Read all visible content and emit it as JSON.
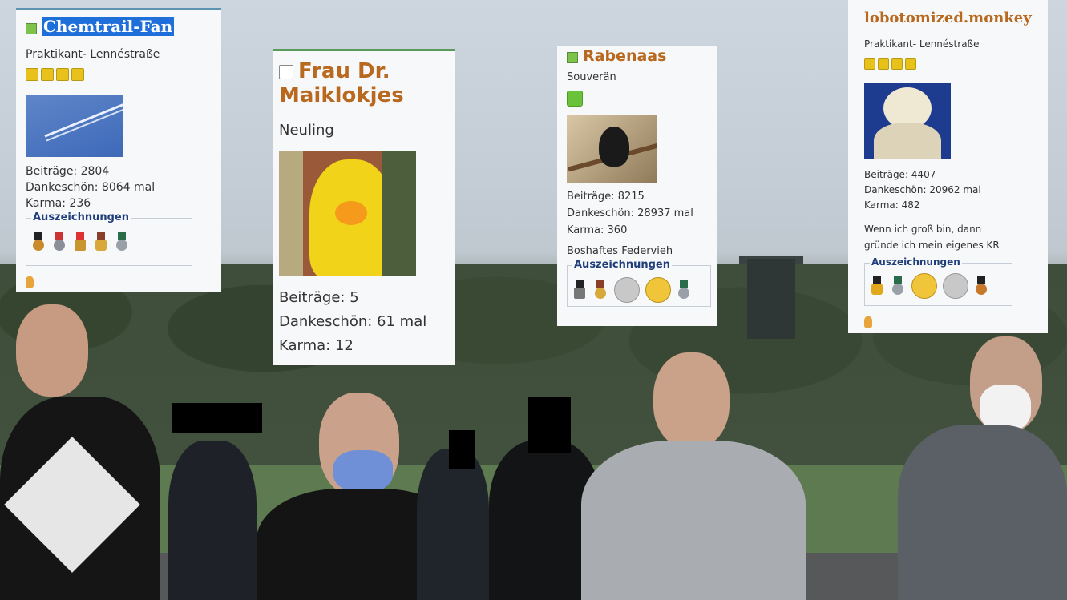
{
  "cards": [
    {
      "id": "chemtrail",
      "name": "Chemtrail-Fan",
      "rank": "Praktikant- Lennéstraße",
      "rank_pips": 4,
      "posts": "Beiträge: 2804",
      "thanks": "Dankeschön: 8064 mal",
      "karma": "Karma: 236",
      "awards_title": "Auszeichnungen",
      "avatar_icon": "airplane-contrail-avatar"
    },
    {
      "id": "maiklokjes",
      "name_line1": "Frau Dr.",
      "name_line2": "Maiklokjes",
      "rank": "Neuling",
      "posts": "Beiträge: 5",
      "thanks": "Dankeschön: 61 mal",
      "karma": "Karma: 12",
      "avatar_icon": "big-bird-avatar"
    },
    {
      "id": "rabenaas",
      "name": "Rabenaas",
      "rank": "Souverän",
      "posts": "Beiträge: 8215",
      "thanks": "Dankeschön: 28937 mal",
      "karma": "Karma: 360",
      "extra": "Boshaftes Federvieh",
      "awards_title": "Auszeichnungen",
      "avatar_icon": "raven-avatar"
    },
    {
      "id": "monkey",
      "name": "lobotomized.monkey",
      "rank": "Praktikant- Lennéstraße",
      "rank_pips": 4,
      "posts": "Beiträge: 4407",
      "thanks": "Dankeschön: 20962 mal",
      "karma": "Karma: 482",
      "signature_line1": "Wenn ich groß bin, dann",
      "signature_line2": "gründe ich mein eigenes KR",
      "awards_title": "Auszeichnungen",
      "avatar_icon": "plush-monkey-avatar"
    }
  ],
  "colors": {
    "name_orange": "#b8691f",
    "selection_blue": "#1e6fd9",
    "awards_title_blue": "#1f3e7a",
    "status_green": "#7dc34a",
    "rank_gold": "#e8c21a"
  }
}
